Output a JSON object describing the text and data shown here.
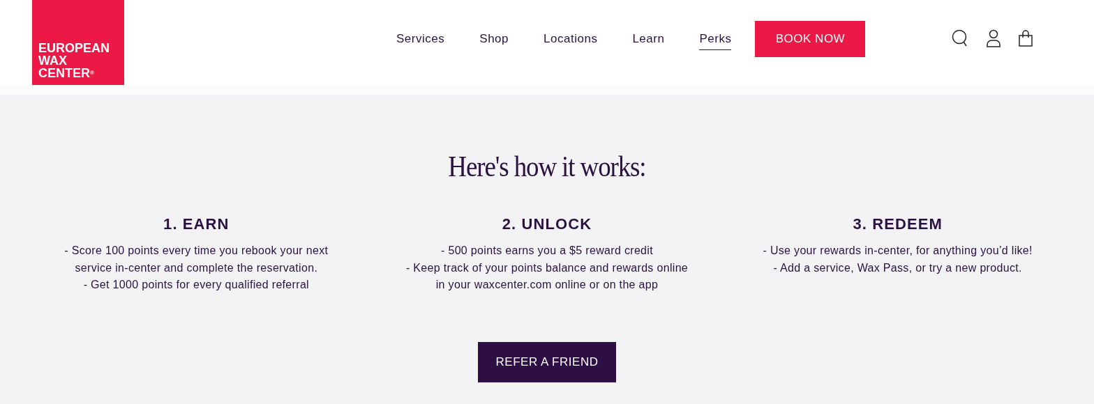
{
  "logo": {
    "lines": [
      "EUROPEAN",
      "WAX",
      "CENTER"
    ],
    "mark": "®"
  },
  "nav": [
    {
      "label": "Services",
      "selected": false
    },
    {
      "label": "Shop",
      "selected": false
    },
    {
      "label": "Locations",
      "selected": false
    },
    {
      "label": "Learn",
      "selected": false
    },
    {
      "label": "Perks",
      "selected": true
    }
  ],
  "book_button": "BOOK NOW",
  "heading": "Here's how it works:",
  "steps": [
    {
      "title": "1. EARN",
      "lines": [
        "- Score 100 points every time you rebook your next",
        "service in-center and complete the reservation.",
        "- Get 1000 points for every qualified referral"
      ]
    },
    {
      "title": "2. UNLOCK",
      "lines": [
        "- 500 points earns you a $5 reward credit",
        "- Keep track of your points balance and rewards online",
        "in your waxcenter.com online or on the app"
      ]
    },
    {
      "title": "3. REDEEM",
      "lines": [
        "- Use your rewards in-center, for anything you’d like!",
        "- Add a service, Wax Pass, or try a new product."
      ]
    }
  ],
  "cta_button": "REFER A FRIEND"
}
